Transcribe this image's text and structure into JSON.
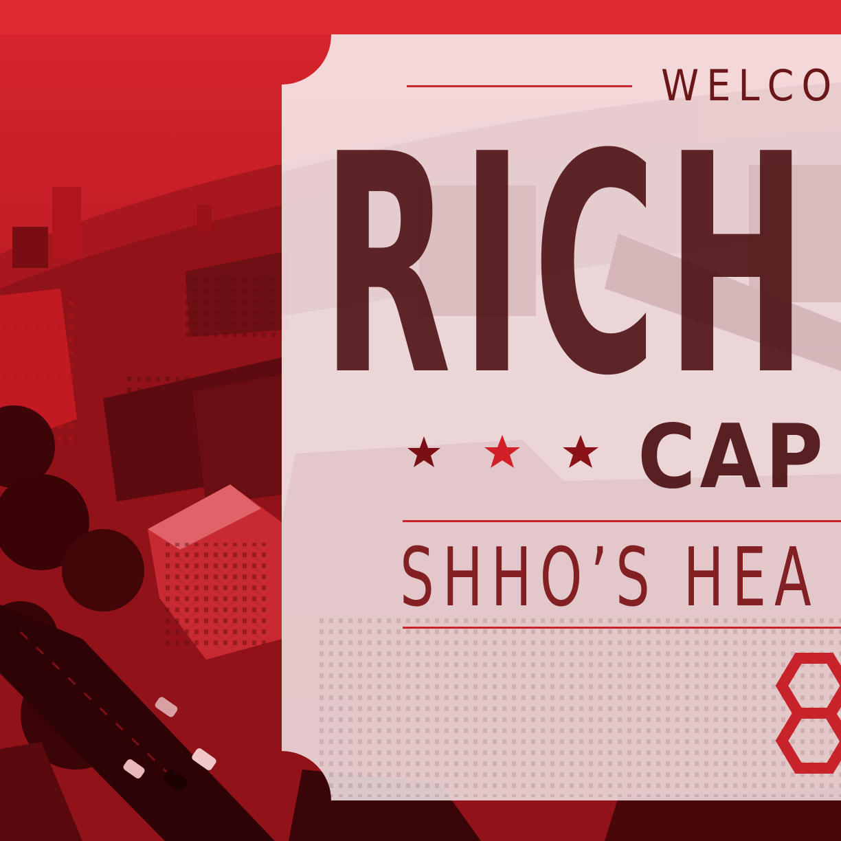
{
  "banner": {
    "welcome": "WELCO",
    "headline": "RICH",
    "subhead": "CAP",
    "tagline": "SHHO’S HEA"
  },
  "colors": {
    "brand_red": "#e02a32",
    "dark_red": "#4a0d10",
    "ticket_fill": "#f7f0f1"
  },
  "icons": {
    "stars": [
      "star-icon",
      "star-icon",
      "star-icon"
    ],
    "logo": "hexagon-logo-icon"
  }
}
